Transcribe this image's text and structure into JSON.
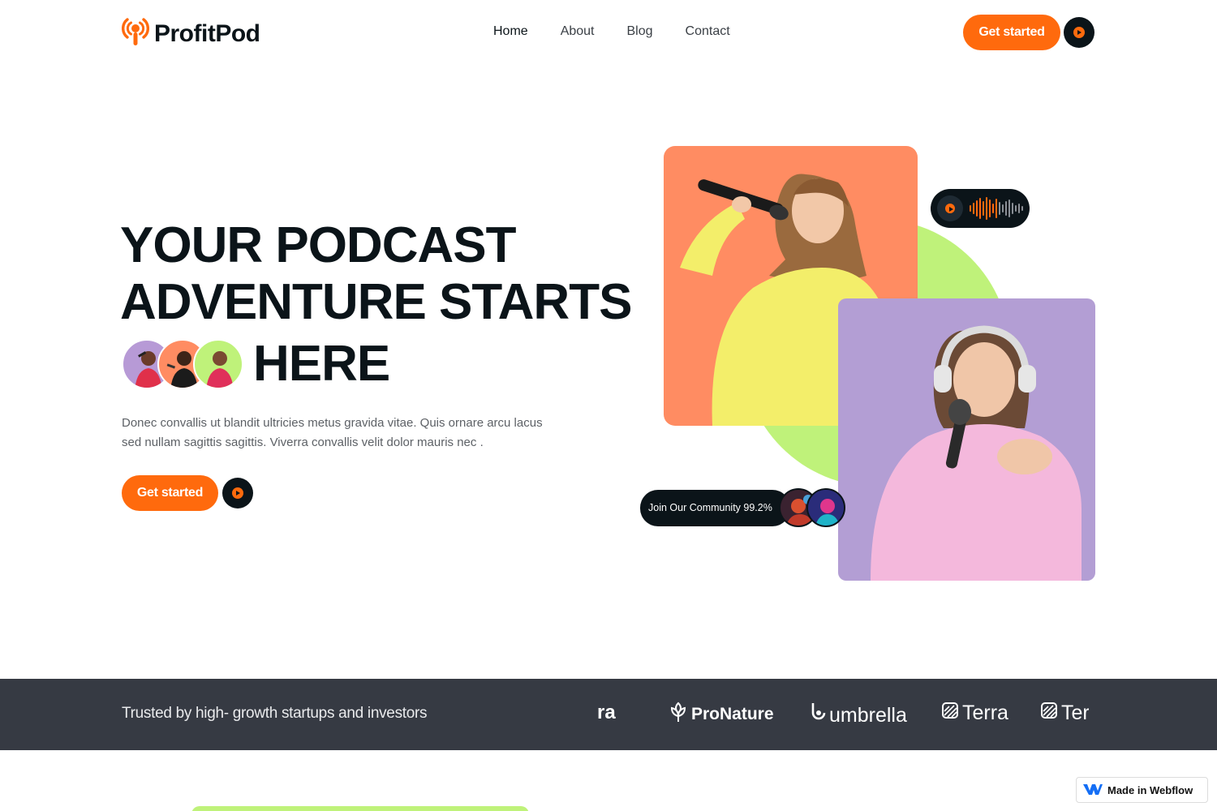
{
  "brand": {
    "name": "ProfitPod",
    "accent": "#ff6a0d",
    "dark": "#0b1419",
    "lime": "#bff27a",
    "icon": "podcast-mic-icon"
  },
  "nav": {
    "links": [
      {
        "label": "Home",
        "active": true
      },
      {
        "label": "About",
        "active": false
      },
      {
        "label": "Blog",
        "active": false
      },
      {
        "label": "Contact",
        "active": false
      }
    ],
    "cta": "Get started",
    "play_icon": "play-icon"
  },
  "hero": {
    "title_line1": "YOUR PODCAST",
    "title_line2": "ADVENTURE STARTS",
    "title_line3": "HERE",
    "description": "Donec convallis ut blandit ultricies metus gravida vitae. Quis ornare arcu lacus sed nullam sagittis sagittis. Viverra convallis velit dolor mauris nec .",
    "cta": "Get started",
    "avatar_colors": [
      "#b79ad6",
      "#ff8c62",
      "#bff27a"
    ]
  },
  "collage": {
    "community_label": "Join Our Community 99.2%",
    "audio_icon": "soundwave-icon"
  },
  "trusted": {
    "label": "Trusted by high- growth startups and investors",
    "logos": [
      "ra",
      "ProNature",
      "umbrella",
      "Terra",
      "Terr"
    ]
  },
  "badge": {
    "label": "Made in Webflow"
  }
}
